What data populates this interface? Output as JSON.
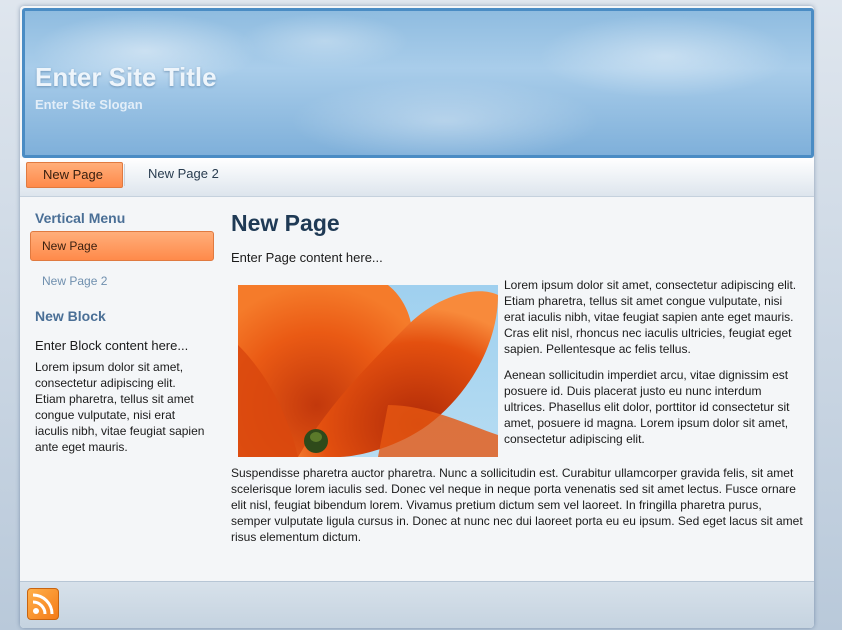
{
  "site": {
    "title": "Enter Site Title",
    "slogan": "Enter Site Slogan"
  },
  "nav": {
    "items": [
      {
        "label": "New Page",
        "active": true
      },
      {
        "label": "New Page 2",
        "active": false
      }
    ]
  },
  "sidebar": {
    "menu_heading": "Vertical Menu",
    "menu_items": [
      {
        "label": "New Page",
        "active": true
      },
      {
        "label": "New Page 2",
        "active": false
      }
    ],
    "block_heading": "New Block",
    "block_intro": "Enter Block content here...",
    "block_text": "Lorem ipsum dolor sit amet, consectetur adipiscing elit. Etiam pharetra, tellus sit amet congue vulputate, nisi erat iaculis nibh, vitae feugiat sapien ante eget mauris."
  },
  "main": {
    "title": "New Page",
    "intro": "Enter Page content here...",
    "paragraph1": "Lorem ipsum dolor sit amet, consectetur adipiscing elit. Etiam pharetra, tellus sit amet congue vulputate, nisi erat iaculis nibh, vitae feugiat sapien ante eget mauris. Cras elit nisl, rhoncus nec iaculis ultricies, feugiat eget sapien. Pellentesque ac felis tellus.",
    "paragraph2": "Aenean sollicitudin imperdiet arcu, vitae dignissim est posuere id. Duis placerat justo eu nunc interdum ultrices. Phasellus elit dolor, porttitor id consectetur sit amet, posuere id magna. Lorem ipsum dolor sit amet, consectetur adipiscing elit.",
    "paragraph3": "Suspendisse pharetra auctor pharetra. Nunc a sollicitudin est. Curabitur ullamcorper gravida felis, sit amet scelerisque lorem iaculis sed. Donec vel neque in neque porta venenatis sed sit amet lectus. Fusce ornare elit nisl, feugiat bibendum lorem. Vivamus pretium dictum sem vel laoreet. In fringilla pharetra purus, semper vulputate ligula cursus in. Donec at nunc nec dui laoreet porta eu eu ipsum. Sed eget lacus sit amet risus elementum dictum."
  },
  "footer": {
    "icon": "rss-icon"
  },
  "colors": {
    "accent": "#ff8a4a",
    "header_border": "#4a8cc4",
    "heading": "#4a6f96"
  }
}
